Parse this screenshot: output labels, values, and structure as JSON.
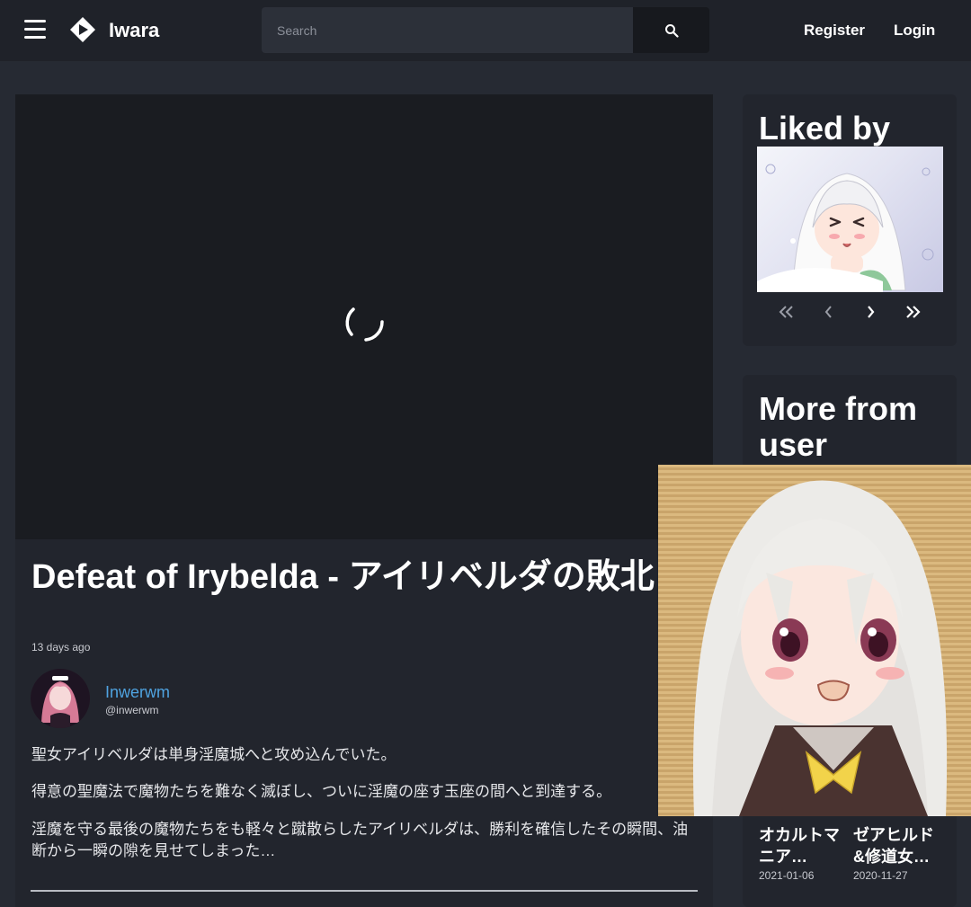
{
  "header": {
    "brand": "Iwara",
    "search_placeholder": "Search",
    "register_label": "Register",
    "login_label": "Login"
  },
  "video": {
    "title": "Defeat of Irybelda - アイリベルダの敗北",
    "posted": "13 days ago",
    "author": {
      "name": "Inwerwm",
      "handle": "@inwerwm"
    },
    "description": [
      "聖女アイリベルダは単身淫魔城へと攻め込んでいた。",
      "得意の聖魔法で魔物たちを難なく滅ぼし、ついに淫魔の座す玉座の間へと到達する。",
      "淫魔を守る最後の魔物たちをも軽々と蹴散らしたアイリベルダは、勝利を確信したその瞬間、油断から一瞬の隙を見せてしまった…"
    ]
  },
  "sidebar": {
    "liked_by_title": "Liked by",
    "more_title": "More from user",
    "more_items": [
      {
        "title": "オカルトマニア…",
        "date": "2021-01-06"
      },
      {
        "title": "ゼアヒルド&修道女…",
        "date": "2020-11-27"
      }
    ]
  },
  "colors": {
    "background": "#262a33",
    "header": "#1f2229",
    "card": "#22252d",
    "author_link": "#4fa3e0"
  }
}
